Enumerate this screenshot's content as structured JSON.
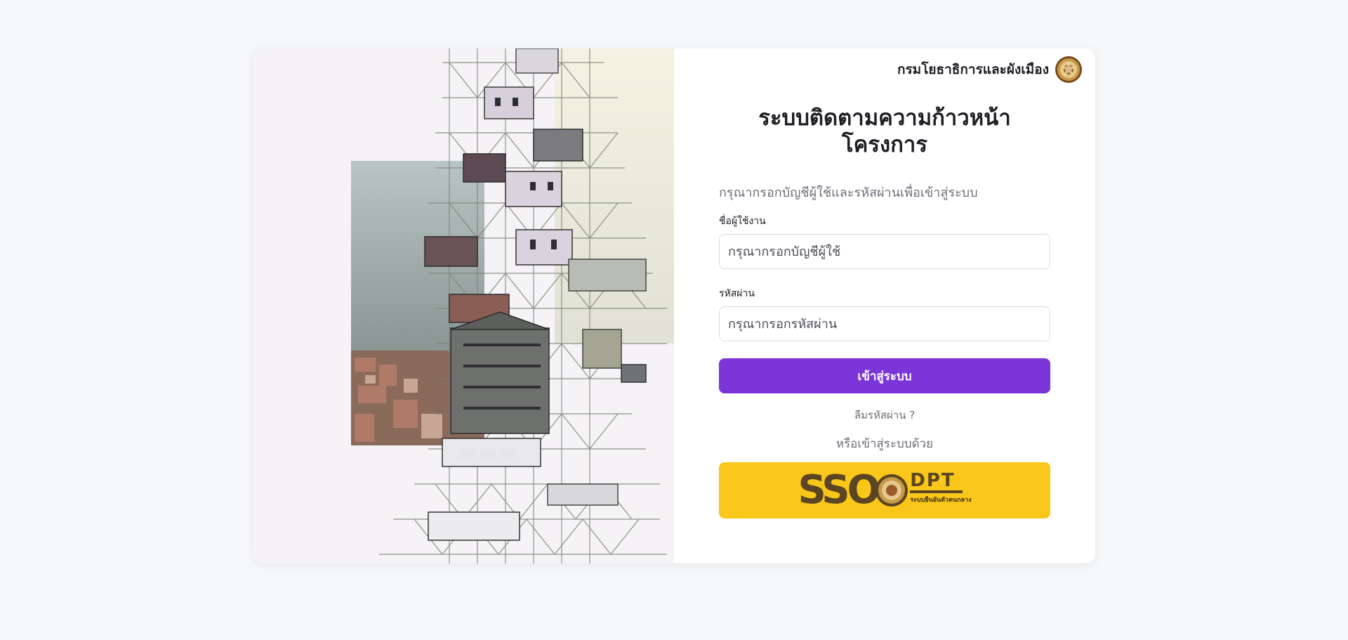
{
  "organization": {
    "name": "กรมโยธาธิการและผังเมือง",
    "seal_icon": "dpt-seal-icon"
  },
  "login": {
    "title_line1": "ระบบติดตามความก้าวหน้า",
    "title_line2": "โครงการ",
    "subtitle": "กรุณากรอกบัญชีผู้ใช้และรหัสผ่านเพื่อเข้าสู่ระบบ",
    "username_label": "ชื่อผู้ใช้งาน",
    "username_placeholder": "กรุณากรอกบัญชีผู้ใช้",
    "username_value": "",
    "password_label": "รหัสผ่าน",
    "password_placeholder": "กรุณากรอกรหัสผ่าน",
    "password_value": "",
    "submit_label": "เข้าสู่ระบบ",
    "forgot_label": "ลืมรหัสผ่าน ?",
    "or_label": "หรือเข้าสู่ระบบด้วย"
  },
  "sso": {
    "logo_sso": "SSO",
    "logo_dpt": "DPT",
    "caption": "ระบบยืนยันตัวตนกลาง"
  },
  "colors": {
    "primary": "#7b35d8",
    "sso_background": "#f9c61a",
    "sso_text": "#5b4522",
    "page_background": "#f7f8fa"
  }
}
